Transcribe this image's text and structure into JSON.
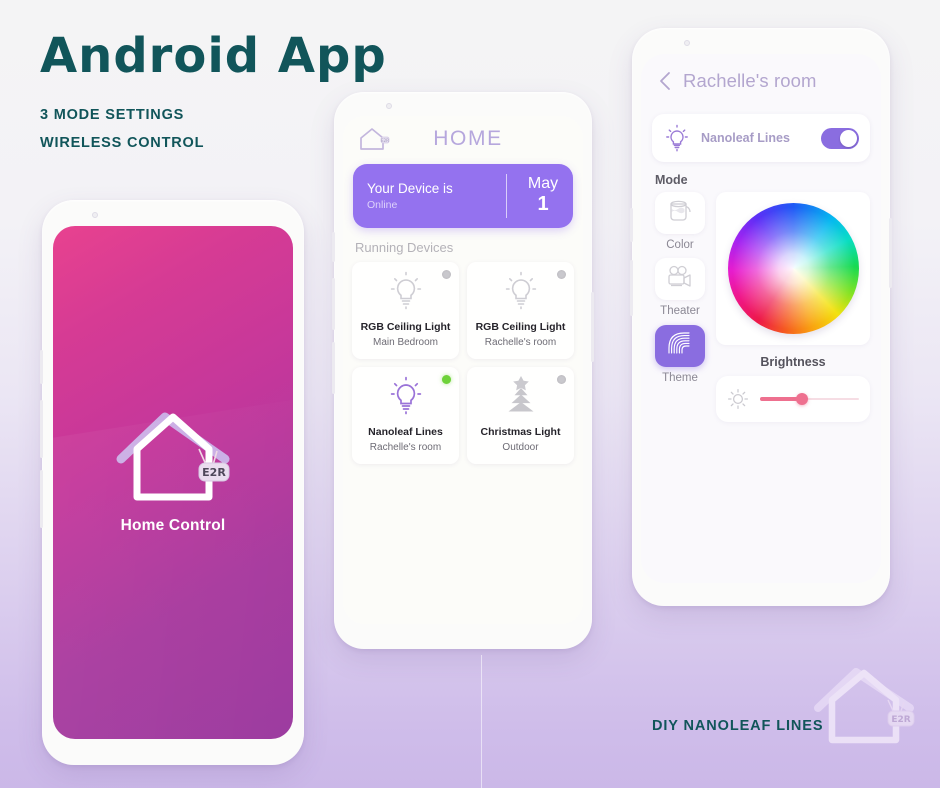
{
  "poster": {
    "title": "Android App",
    "subtitle_lines": [
      "3 MODE SETTINGS",
      "WIRELESS CONTROL"
    ],
    "footer_caption": "DIY NANOLEAF LINES",
    "brand_tag": "E2R",
    "accent_teal": "#11555a",
    "accent_purple": "#8a6de0",
    "background_top": "#f4f4f5",
    "background_bottom": "#cbb8e8"
  },
  "splash_screen": {
    "app_name": "Home Control",
    "logo_icon": "house-logo-icon",
    "brand_tag": "E2R",
    "gradient_from": "#e8428f",
    "gradient_to": "#9b3a9f"
  },
  "home_screen": {
    "header": {
      "home_icon": "house-icon",
      "title": "HOME"
    },
    "status_card": {
      "line1": "Your Device is",
      "line2": "Online",
      "month": "May",
      "day": "1",
      "background": "#9472ef"
    },
    "section_title": "Running Devices",
    "devices": [
      {
        "name": "RGB Ceiling Light",
        "room": "Main Bedroom",
        "icon": "bulb-icon",
        "state": "off",
        "dot_color": "#c9c8cd",
        "icon_color": "#cecdd3"
      },
      {
        "name": "RGB Ceiling Light",
        "room": "Rachelle's room",
        "icon": "bulb-icon",
        "state": "off",
        "dot_color": "#c9c8cd",
        "icon_color": "#cecdd3"
      },
      {
        "name": "Nanoleaf Lines",
        "room": "Rachelle's room",
        "icon": "bulb-icon",
        "state": "on",
        "dot_color": "#6ed239",
        "icon_color": "#9a73d8"
      },
      {
        "name": "Christmas Light",
        "room": "Outdoor",
        "icon": "christmas-tree-icon",
        "state": "off",
        "dot_color": "#c9c8cd",
        "icon_color": "#c8c7cc"
      }
    ]
  },
  "control_screen": {
    "header": {
      "back_icon": "chevron-left-icon",
      "title": "Rachelle's room"
    },
    "device_row": {
      "icon": "bulb-icon",
      "name": "Nanoleaf Lines",
      "toggle_state": "on",
      "toggle_color": "#8a6de0"
    },
    "mode_label": "Mode",
    "modes": [
      {
        "name": "Color",
        "icon": "paint-bucket-icon",
        "selected": false
      },
      {
        "name": "Theater",
        "icon": "movie-camera-icon",
        "selected": false
      },
      {
        "name": "Theme",
        "icon": "nanoleaf-lines-icon",
        "selected": true
      }
    ],
    "color_wheel": {
      "icon": "color-wheel-picker",
      "label": ""
    },
    "brightness": {
      "label": "Brightness",
      "icon": "sun-icon",
      "value_percent": 42,
      "track_color": "#f6dde4",
      "fill_color": "#ee708f"
    }
  }
}
